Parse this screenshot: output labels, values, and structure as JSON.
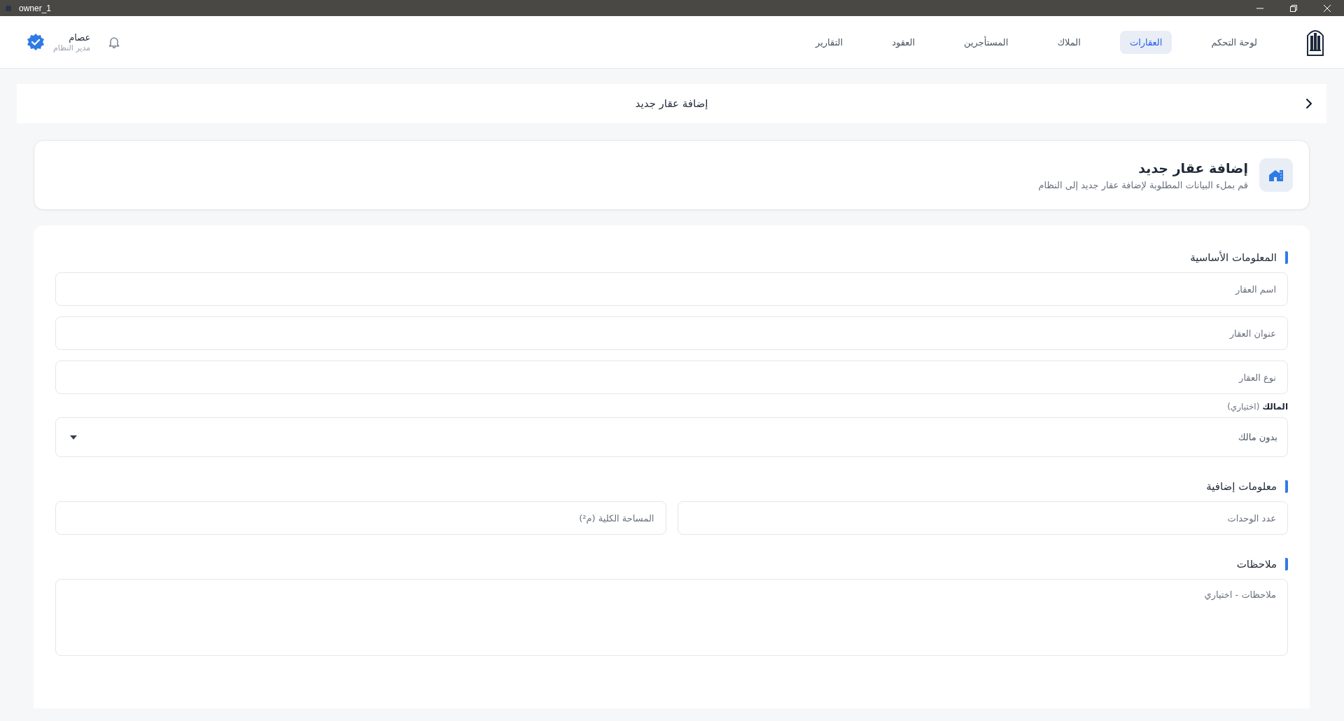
{
  "window": {
    "title": "owner_1"
  },
  "header": {
    "nav": [
      {
        "label": "لوحة التحكم",
        "selected": false
      },
      {
        "label": "العقارات",
        "selected": true
      },
      {
        "label": "الملاك",
        "selected": false
      },
      {
        "label": "المستأجرين",
        "selected": false
      },
      {
        "label": "العقود",
        "selected": false
      },
      {
        "label": "التقارير",
        "selected": false
      }
    ],
    "user": {
      "name": "عصام",
      "role": "مدير النظام"
    }
  },
  "breadcrumb": {
    "title": "إضافة عقار جديد"
  },
  "intro": {
    "title": "إضافة عقار جديد",
    "subtitle": "قم بملء البيانات المطلوبة لإضافة عقار جديد إلى النظام"
  },
  "form": {
    "sections": [
      {
        "title": "المعلومات الأساسية",
        "kind": "stack",
        "fields": [
          {
            "kind": "text",
            "placeholder": "اسم العقار"
          },
          {
            "kind": "text",
            "placeholder": "عنوان العقار"
          },
          {
            "kind": "text",
            "placeholder": "نوع العقار"
          },
          {
            "kind": "select",
            "label": "**المالك** (اختياري)",
            "value": "بدون مالك"
          }
        ]
      },
      {
        "title": "معلومات إضافية",
        "kind": "row",
        "fields": [
          {
            "kind": "text",
            "placeholder": "عدد الوحدات"
          },
          {
            "kind": "text",
            "placeholder": "المساحة الكلية (م²)"
          }
        ]
      },
      {
        "title": "ملاحظات",
        "kind": "stack",
        "fields": [
          {
            "kind": "textarea",
            "placeholder": "ملاحظات - اختياري"
          }
        ]
      }
    ]
  }
}
